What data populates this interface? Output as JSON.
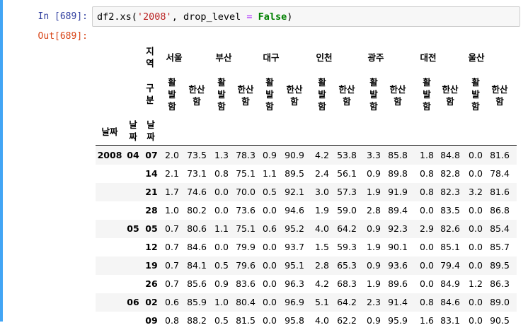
{
  "notebook": {
    "in_prompt": "In [689]:",
    "out_prompt": "Out[689]:",
    "code_tokens": [
      {
        "text": "df2.xs(",
        "cls": ""
      },
      {
        "text": "'2008'",
        "cls": "tok-str"
      },
      {
        "text": ", drop_level ",
        "cls": ""
      },
      {
        "text": "=",
        "cls": "tok-op"
      },
      {
        "text": " ",
        "cls": ""
      },
      {
        "text": "False",
        "cls": "tok-kw"
      },
      {
        "text": ")",
        "cls": ""
      }
    ]
  },
  "table": {
    "col_level0_name": "지역",
    "col_level1_name": "구분",
    "index_names": [
      "날짜",
      "날짜",
      "날짜"
    ],
    "regions": [
      "서울",
      "부산",
      "대구",
      "인천",
      "광주",
      "대전",
      "울산"
    ],
    "subcols": [
      "활발함",
      "한산함"
    ],
    "rows": [
      {
        "y": "2008",
        "m": "04",
        "d": "07",
        "v": [
          "2.0",
          "73.5",
          "1.3",
          "78.3",
          "0.9",
          "90.9",
          "4.2",
          "53.8",
          "3.3",
          "85.8",
          "1.8",
          "84.8",
          "0.0",
          "81.6"
        ]
      },
      {
        "y": "",
        "m": "",
        "d": "14",
        "v": [
          "2.1",
          "73.1",
          "0.8",
          "75.1",
          "1.1",
          "89.5",
          "2.4",
          "56.1",
          "0.9",
          "89.8",
          "0.8",
          "82.8",
          "0.0",
          "78.4"
        ]
      },
      {
        "y": "",
        "m": "",
        "d": "21",
        "v": [
          "1.7",
          "74.6",
          "0.0",
          "70.0",
          "0.5",
          "92.1",
          "3.0",
          "57.3",
          "1.9",
          "91.9",
          "0.8",
          "82.3",
          "3.2",
          "81.6"
        ]
      },
      {
        "y": "",
        "m": "",
        "d": "28",
        "v": [
          "1.0",
          "80.2",
          "0.0",
          "73.6",
          "0.0",
          "94.6",
          "1.9",
          "59.0",
          "2.8",
          "89.4",
          "0.0",
          "83.5",
          "0.0",
          "86.8"
        ]
      },
      {
        "y": "",
        "m": "05",
        "d": "05",
        "v": [
          "0.7",
          "80.6",
          "1.1",
          "75.1",
          "0.6",
          "95.2",
          "4.0",
          "64.2",
          "0.9",
          "92.3",
          "2.9",
          "82.6",
          "0.0",
          "85.4"
        ]
      },
      {
        "y": "",
        "m": "",
        "d": "12",
        "v": [
          "0.7",
          "84.6",
          "0.0",
          "79.9",
          "0.0",
          "93.7",
          "1.5",
          "59.3",
          "1.9",
          "90.1",
          "0.0",
          "85.1",
          "0.0",
          "85.7"
        ]
      },
      {
        "y": "",
        "m": "",
        "d": "19",
        "v": [
          "0.7",
          "84.1",
          "0.5",
          "79.6",
          "0.0",
          "95.1",
          "2.8",
          "65.3",
          "0.9",
          "93.6",
          "0.0",
          "79.4",
          "0.0",
          "89.5"
        ]
      },
      {
        "y": "",
        "m": "",
        "d": "26",
        "v": [
          "0.7",
          "85.6",
          "0.9",
          "83.6",
          "0.0",
          "96.3",
          "4.2",
          "68.3",
          "1.9",
          "89.6",
          "0.0",
          "84.9",
          "1.2",
          "86.3"
        ]
      },
      {
        "y": "",
        "m": "06",
        "d": "02",
        "v": [
          "0.6",
          "85.9",
          "1.0",
          "80.4",
          "0.0",
          "96.9",
          "5.1",
          "64.2",
          "2.3",
          "91.4",
          "0.8",
          "84.6",
          "0.0",
          "89.0"
        ]
      },
      {
        "y": "",
        "m": "",
        "d": "09",
        "v": [
          "0.8",
          "88.2",
          "0.5",
          "81.5",
          "0.0",
          "95.8",
          "4.0",
          "62.2",
          "0.9",
          "95.9",
          "1.6",
          "83.1",
          "0.0",
          "90.5"
        ]
      }
    ]
  }
}
